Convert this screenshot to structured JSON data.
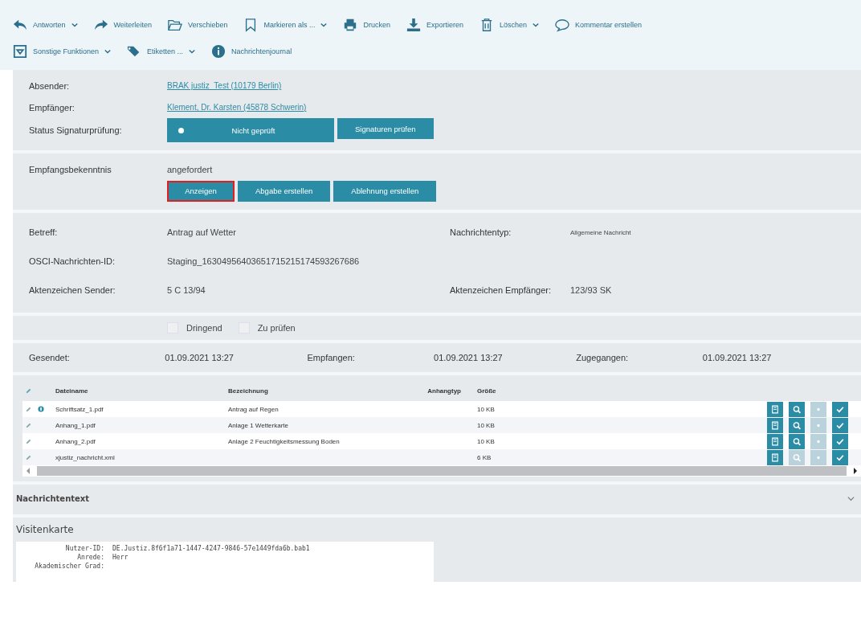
{
  "toolbar": [
    {
      "kind": "reply",
      "label": "Antworten",
      "dropdown": true
    },
    {
      "kind": "forward",
      "label": "Weiterleiten",
      "dropdown": false
    },
    {
      "kind": "folder",
      "label": "Verschieben",
      "dropdown": false
    },
    {
      "kind": "bookmark",
      "label": "Markieren als ...",
      "dropdown": true
    },
    {
      "kind": "print",
      "label": "Drucken",
      "dropdown": false
    },
    {
      "kind": "download",
      "label": "Exportieren",
      "dropdown": false
    },
    {
      "kind": "trash",
      "label": "Löschen",
      "dropdown": true
    },
    {
      "kind": "comment",
      "label": "Kommentar erstellen",
      "dropdown": false
    },
    {
      "kind": "box",
      "label": "Sonstige Funktionen",
      "dropdown": true
    },
    {
      "kind": "tag",
      "label": "Etiketten ...",
      "dropdown": true
    },
    {
      "kind": "info",
      "label": "Nachrichtenjournal",
      "dropdown": false
    }
  ],
  "sender": {
    "label": "Absender:",
    "value": "BRAK justiz_Test (10179 Berlin)"
  },
  "recipient": {
    "label": "Empfänger:",
    "value": "Klement, Dr. Karsten (45878 Schwerin)"
  },
  "signature": {
    "label": "Status Signaturprüfung:",
    "status": "Nicht geprüft",
    "button": "Signaturen prüfen"
  },
  "receipt": {
    "label": "Empfangsbekenntnis",
    "value": "angefordert",
    "buttons": [
      {
        "label": "Anzeigen",
        "selected": true
      },
      {
        "label": "Abgabe erstellen",
        "selected": false
      },
      {
        "label": "Ablehnung erstellen",
        "selected": false
      }
    ]
  },
  "details": [
    {
      "label": "Betreff:",
      "value": "Antrag auf Wetter",
      "label2": "Nachrichtentyp:",
      "value2": "Allgemeine Nachricht"
    },
    {
      "label": "OSCI-Nachrichten-ID:",
      "value": "Staging_16304956403651715215174593267686"
    },
    {
      "label": "Aktenzeichen Sender:",
      "value": "5 C 13/94",
      "label2": "Aktenzeichen Empfänger:",
      "value2": "123/93 SK"
    }
  ],
  "flags": [
    {
      "label": "Dringend",
      "checked": false
    },
    {
      "label": "Zu prüfen",
      "checked": false
    }
  ],
  "dates": [
    {
      "label": "Gesendet:",
      "value": "01.09.2021 13:27"
    },
    {
      "label": "Empfangen:",
      "value": "01.09.2021 13:27"
    },
    {
      "label": "Zugegangen:",
      "value": "01.09.2021 13:27"
    }
  ],
  "table": {
    "columns": [
      "Dateiname",
      "Bezeichnung",
      "Anhangtyp",
      "Größe"
    ],
    "rows": [
      {
        "file": "Schriftsatz_1.pdf",
        "main": true,
        "description": "Antrag auf Regen",
        "size": "10 KB",
        "preview": true
      },
      {
        "file": "Anhang_1.pdf",
        "main": false,
        "description": "Anlage 1 Wetterkarte",
        "size": "10 KB",
        "preview": true
      },
      {
        "file": "Anhang_2.pdf",
        "main": false,
        "description": "Anlage 2 Feuchtigkeitsmessung Boden",
        "size": "10 KB",
        "preview": true
      },
      {
        "file": "xjustiz_nachricht.xml",
        "main": false,
        "size": "6 KB",
        "preview": false
      }
    ]
  },
  "message_text": {
    "title": "Nachrichtentext",
    "expanded": false
  },
  "card": {
    "title": "Visitenkarte",
    "rows": [
      {
        "label": "Nutzer-ID:",
        "value": "DE.Justiz.8f6f1a71-1447-4247-9846-57e1449fda6b.bab1"
      },
      {
        "label": "Anrede:",
        "value": "Herr"
      },
      {
        "label": "Akademischer Grad:"
      }
    ]
  }
}
